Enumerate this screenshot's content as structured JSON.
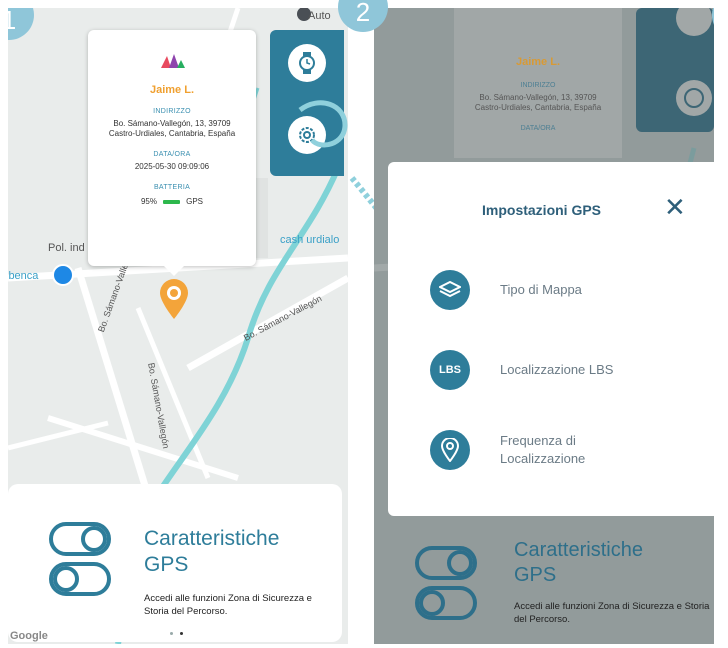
{
  "steps": {
    "one": "1",
    "two": "2"
  },
  "map": {
    "top_label": "Auto",
    "label_polind": "Pol. ind",
    "label_ibenca": "ibenca",
    "label_cash": "cash urdialo",
    "street_1": "Bo. Sámano-Vallegón",
    "street_2": "Bo. Sámano-Vallegón",
    "street_3": "Bo. Sámano-Vallegón",
    "google": "Google"
  },
  "popup": {
    "name": "Jaime L.",
    "address_label": "INDIRIZZO",
    "address_line1": "Bo. Sámano-Vallegón, 13, 39709",
    "address_line2": "Castro-Urdiales, Cantabria, España",
    "datetime_label": "DATA/ORA",
    "datetime_value": "2025-05-30 09:09:06",
    "battery_label": "BATTERIA",
    "battery_percent": "95%",
    "battery_level": 0.95,
    "battery_source": "GPS"
  },
  "card": {
    "title_line1": "Caratteristiche",
    "title_line2": "GPS",
    "description": "Accedi alle funzioni Zona di Sicurezza e Storia del Percorso."
  },
  "modal": {
    "title": "Impostazioni GPS",
    "close": "✕",
    "items": [
      {
        "label": "Tipo di Mappa",
        "icon": "layers-icon"
      },
      {
        "label": "Localizzazione LBS",
        "icon": "LBS"
      },
      {
        "label": "Frequenza di Localizzazione",
        "icon": "location-pin-icon"
      }
    ]
  },
  "colors": {
    "accent": "#2e7d9a",
    "name_orange": "#f0a030",
    "battery_green": "#2db84c",
    "step_badge": "#8fc6d9"
  }
}
